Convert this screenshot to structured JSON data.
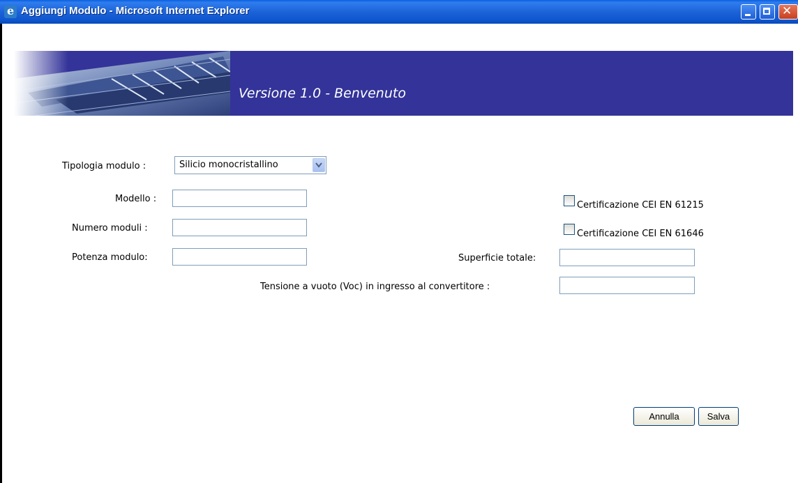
{
  "window": {
    "title": "Aggiungi Modulo - Microsoft Internet Explorer",
    "app_icon": "internet-explorer-icon"
  },
  "banner": {
    "text": "Versione 1.0 - Benvenuto",
    "background": "#333399",
    "image": "solar-panels-photo"
  },
  "form": {
    "tipologia_label": "Tipologia modulo :",
    "tipologia_value": "Silicio monocristallino",
    "modello_label": "Modello :",
    "modello_value": "",
    "numero_label": "Numero moduli :",
    "numero_value": "",
    "potenza_label": "Potenza modulo:",
    "potenza_value": "",
    "cert1_label": "Certificazione CEI EN 61215",
    "cert1_checked": false,
    "cert2_label": "Certificazione CEI EN 61646",
    "cert2_checked": false,
    "superficie_label": "Superficie totale:",
    "superficie_value": "",
    "tensione_label": "Tensione a vuoto (Voc) in ingresso al convertitore :",
    "tensione_value": ""
  },
  "buttons": {
    "annulla": "Annulla",
    "salva": "Salva"
  }
}
